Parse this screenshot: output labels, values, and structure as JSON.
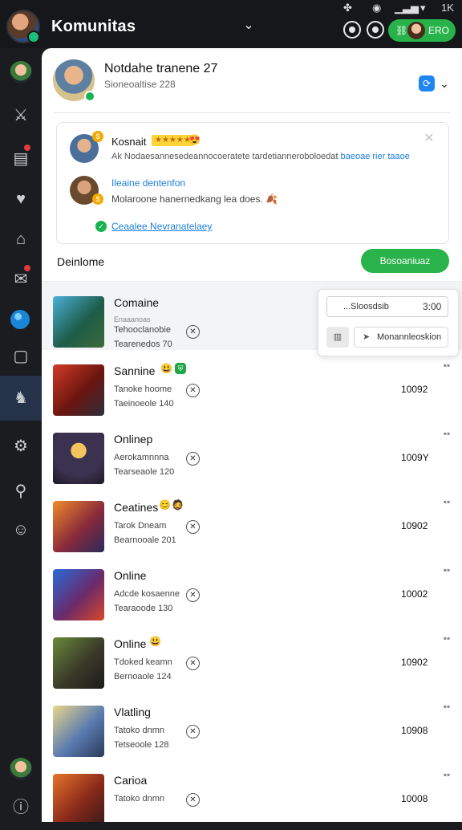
{
  "status": {
    "time": "1K"
  },
  "topbar": {
    "title": "Komunitas",
    "pill_label": "ERO"
  },
  "profile": {
    "name": "Notdahe tranene 27",
    "subtitle": "Sioneoaltise 228"
  },
  "notification": {
    "name": "Kosnait",
    "stars": "★★★★★",
    "text_prefix": "Ak Nodaesannesedeannocoeratete tardetianneroboloedat",
    "text_link": "baeoae rier taaoe",
    "link": "Ileaine dentenfon",
    "text2": "Molaroone hanernedkang lea does.",
    "action": "Ceaalee Nevranatelaey"
  },
  "section": {
    "label": "Deinlome",
    "button": "Bosoaniuaz"
  },
  "popup": {
    "placeholder": "...Sloosdsib",
    "time": "3:00",
    "button": "Monannleoskion"
  },
  "rows": [
    {
      "title": "Comaine",
      "l0": "Enaaanoas",
      "l1": "Tehooclanobie",
      "l2": "Tearenedos 70",
      "val": ""
    },
    {
      "title": "Sannine",
      "l1": "Tanoke hoome",
      "l2": "Taeinoeole 140",
      "val": "10092"
    },
    {
      "title": "Onlinep",
      "l1": "Aerokamnnna",
      "l2": "Tearseaole 120",
      "val": "1009Y"
    },
    {
      "title": "Ceatines",
      "l1": "Tarok Dneam",
      "l2": "Bearnooale 201",
      "val": "10902"
    },
    {
      "title": "Online",
      "l1": "Adcde kosaenne",
      "l2": "Tearaoode 130",
      "val": "10002"
    },
    {
      "title": "Online",
      "l1": "Tdoked keamn",
      "l2": "Bernoaole 124",
      "val": "10902"
    },
    {
      "title": "Vlatling",
      "l1": "Tatoko dnmn",
      "l2": "Tetseoole 128",
      "val": "10908"
    },
    {
      "title": "Carioa",
      "l1": "Tatoko dnmn",
      "l2": "",
      "val": "10008"
    }
  ]
}
